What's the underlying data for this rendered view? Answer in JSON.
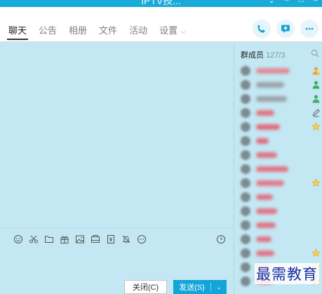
{
  "window": {
    "title": "IPTV技..."
  },
  "tabs": [
    {
      "label": "聊天"
    },
    {
      "label": "公告"
    },
    {
      "label": "相册"
    },
    {
      "label": "文件"
    },
    {
      "label": "活动"
    },
    {
      "label": "设置"
    }
  ],
  "toolbar_icons": [
    "emoji-icon",
    "scissors-icon",
    "folder-icon",
    "gift-icon",
    "image-icon",
    "screenshot-icon",
    "receipt-icon",
    "bell-mute-icon",
    "more-circle-icon"
  ],
  "input": {
    "close_label": "关闭(C)",
    "send_label": "发送(S)"
  },
  "members": {
    "title": "群成员",
    "count": "127/3",
    "rows": [
      {
        "role": "owner",
        "name_color": "#e08a98"
      },
      {
        "role": "admin",
        "name_color": "#9aa3a8"
      },
      {
        "role": "admin",
        "name_color": "#9aa3a8"
      },
      {
        "role": "edit",
        "name_color": "#e07585"
      },
      {
        "role": "star",
        "name_color": "#e26c7e"
      },
      {
        "role": "none",
        "name_color": "#e26c7e"
      },
      {
        "role": "none",
        "name_color": "#e07585"
      },
      {
        "role": "none",
        "name_color": "#e07585"
      },
      {
        "role": "star",
        "name_color": "#e5798b"
      },
      {
        "role": "none",
        "name_color": "#e07585"
      },
      {
        "role": "none",
        "name_color": "#e07585"
      },
      {
        "role": "none",
        "name_color": "#e07585"
      },
      {
        "role": "none",
        "name_color": "#e07585"
      },
      {
        "role": "star",
        "name_color": "#e07585"
      },
      {
        "role": "star",
        "name_color": "#e07585"
      },
      {
        "role": "star",
        "name_color": "#e07585"
      }
    ]
  },
  "watermark": "最需教育",
  "colors": {
    "titlebar": "#19abd8",
    "chat_bg": "#c3e8f3",
    "send_button": "#13a5d9",
    "tab_icon": "#1aa1d6"
  }
}
